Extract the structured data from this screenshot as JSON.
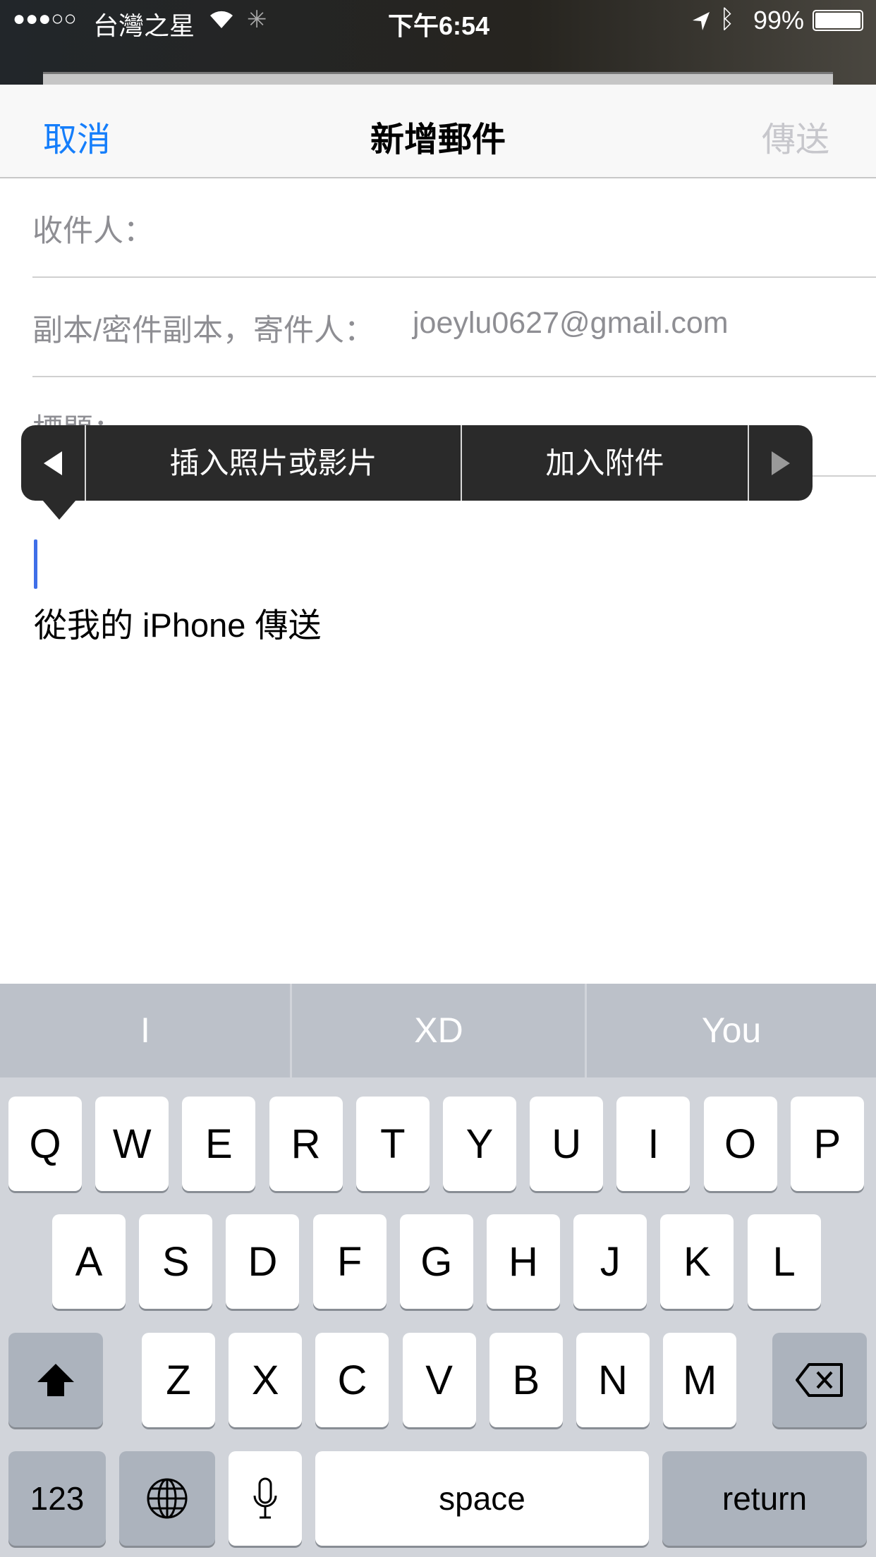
{
  "status_bar": {
    "signal": "●●●○○",
    "carrier": "台灣之星",
    "time": "下午6:54",
    "battery": "99%"
  },
  "nav": {
    "cancel": "取消",
    "title": "新增郵件",
    "send": "傳送"
  },
  "fields": {
    "to_label": "收件人：",
    "cc_label": "副本/密件副本，寄件人：",
    "cc_value": "joeylu0627@gmail.com",
    "subject_label": "標題："
  },
  "popup": {
    "insert_media": "插入照片或影片",
    "add_attachment": "加入附件"
  },
  "body": {
    "signature": "從我的 iPhone 傳送"
  },
  "keyboard": {
    "suggestions": [
      "I",
      "XD",
      "You"
    ],
    "row1": [
      "Q",
      "W",
      "E",
      "R",
      "T",
      "Y",
      "U",
      "I",
      "O",
      "P"
    ],
    "row2": [
      "A",
      "S",
      "D",
      "F",
      "G",
      "H",
      "J",
      "K",
      "L"
    ],
    "row3": [
      "Z",
      "X",
      "C",
      "V",
      "B",
      "N",
      "M"
    ],
    "numbers": "123",
    "space": "space",
    "return": "return"
  },
  "colors": {
    "accent": "#157efb",
    "disabled": "#c7c7cc",
    "cursor": "#3f6fe8"
  }
}
